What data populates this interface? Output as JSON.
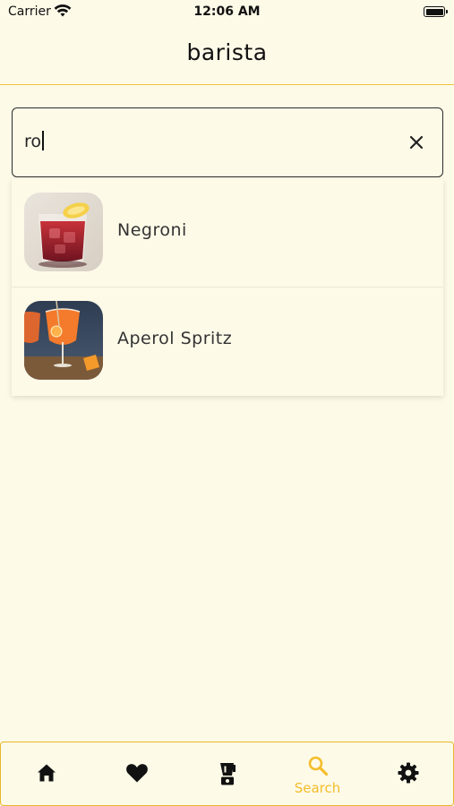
{
  "status_bar": {
    "carrier": "Carrier",
    "time": "12:06 AM"
  },
  "header": {
    "title": "barista"
  },
  "search": {
    "value": "ro"
  },
  "results": [
    {
      "name": "Negroni",
      "image": "negroni-cocktail-photo"
    },
    {
      "name": "Aperol Spritz",
      "image": "aperol-spritz-cocktail-photo"
    }
  ],
  "tab_bar": {
    "active_color": "#F4BD2B",
    "tabs": [
      {
        "icon": "home-icon"
      },
      {
        "icon": "heart-icon"
      },
      {
        "icon": "blender-icon"
      },
      {
        "icon": "search-icon",
        "label": "Search",
        "active": true
      },
      {
        "icon": "gear-icon"
      }
    ]
  },
  "colors": {
    "background": "#FEFAE8",
    "accent": "#F0C43A"
  }
}
